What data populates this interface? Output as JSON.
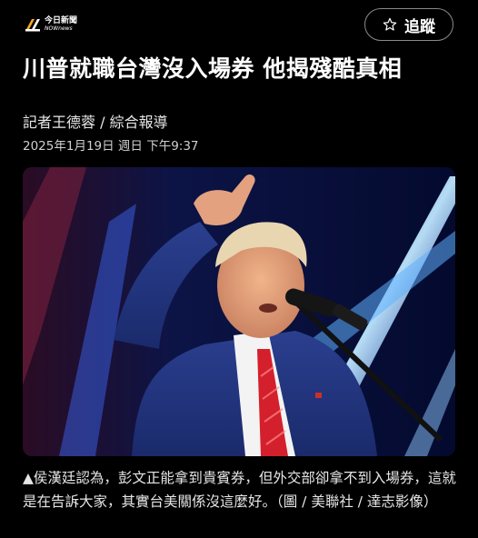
{
  "header": {
    "logo_cn": "今日新聞",
    "logo_en": "NOWnews",
    "follow_label": "追蹤"
  },
  "article": {
    "title": "川普就職台灣沒入場券 他揭殘酷真相",
    "byline": "記者王德蓉 / 綜合報導",
    "date": "2025年1月19日 週日 下午9:37",
    "caption": "▲侯漢廷認為，彭文正能拿到貴賓券，但外交部卻拿不到入場券，這就是在告訴大家，其實台美關係沒這麼好。（圖 / 美聯社 / 達志影像）"
  },
  "icons": [
    "nownews-logo-icon",
    "star-icon"
  ],
  "colors": {
    "background": "#000000",
    "button_border": "#8a8a8a",
    "logo_orange": "#f5a623"
  }
}
